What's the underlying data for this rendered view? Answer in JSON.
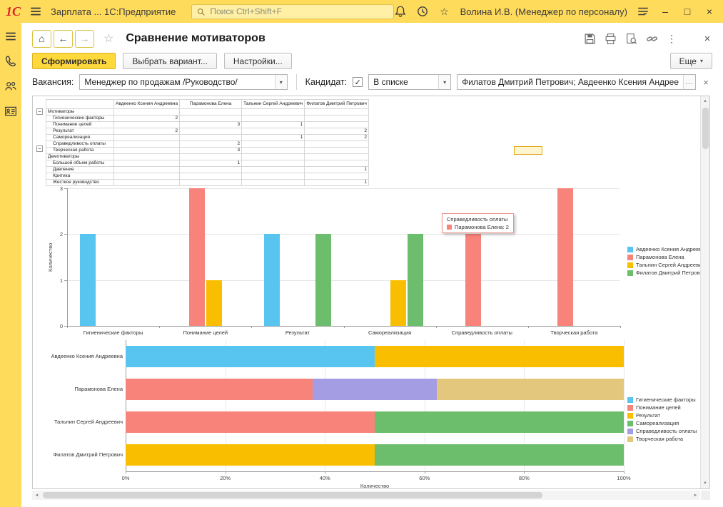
{
  "titlebar": {
    "logo": "1С",
    "app_title": "Зарплата ...  1С:Предприятие",
    "search_placeholder": "Поиск Ctrl+Shift+F",
    "user_name": "Волина И.В. (Менеджер по персоналу)"
  },
  "icons": {
    "minimize": "–",
    "maximize": "□",
    "close": "×",
    "kebab": "⋮",
    "dropdown": "▾",
    "check": "✓",
    "choose": "...",
    "back": "←",
    "forward": "→",
    "star": "☆",
    "home": "⌂",
    "expand": "−",
    "scroll_up": "▲",
    "scroll_down": "▼",
    "scroll_left": "◄",
    "scroll_right": "►"
  },
  "form": {
    "title": "Сравнение мотиваторов",
    "buttons": {
      "generate": "Сформировать",
      "variant": "Выбрать вариант...",
      "settings": "Настройки...",
      "more": "Еще"
    },
    "filters": {
      "vacancy_label": "Вакансия:",
      "vacancy_value": "Менеджер по продажам /Руководство/",
      "candidate_label": "Кандидат:",
      "candidate_checked": true,
      "candidate_condition": "В списке",
      "candidate_value": "Филатов Дмитрий Петрович; Авдеенко Ксения Андрее"
    }
  },
  "colors": {
    "titlebar_yellow": "#ffdb5c",
    "primary_button_yellow": "#ffd83c",
    "selection_border": "#dfa713"
  },
  "pivot": {
    "columns": [
      "Авдеенко Ксения Андреевна",
      "Парамонова Елена",
      "Тальнин Сергей Андреевич",
      "Филатов Дмитрий Петрович"
    ],
    "groups": [
      {
        "label": "Мотиваторы",
        "rows": [
          {
            "label": "Гигиенические факторы",
            "values": [
              "2",
              "",
              "",
              ""
            ]
          },
          {
            "label": "Понимание целей",
            "values": [
              "",
              "3",
              "1",
              ""
            ]
          },
          {
            "label": "Результат",
            "values": [
              "2",
              "",
              "",
              "2"
            ]
          },
          {
            "label": "Самореализация",
            "values": [
              "",
              "",
              "1",
              "2"
            ]
          },
          {
            "label": "Справедливость оплаты",
            "values": [
              "",
              "2",
              "",
              ""
            ]
          },
          {
            "label": "Творческая работа",
            "values": [
              "",
              "3",
              "",
              ""
            ]
          }
        ]
      },
      {
        "label": "Демотиваторы",
        "rows": [
          {
            "label": "Большой объем работы",
            "values": [
              "",
              "1",
              "",
              ""
            ]
          },
          {
            "label": "Давление",
            "values": [
              "",
              "",
              "",
              "1"
            ]
          },
          {
            "label": "Критика",
            "values": [
              "",
              "",
              "",
              ""
            ]
          },
          {
            "label": "Жесткое руководство",
            "values": [
              "",
              "",
              "",
              "1"
            ]
          }
        ]
      }
    ]
  },
  "chart_data": [
    {
      "type": "bar",
      "title": "",
      "categories": [
        "Гигиенические факторы",
        "Понимание целей",
        "Результат",
        "Самореализация",
        "Справедливость оплаты",
        "Творческая работа"
      ],
      "series": [
        {
          "name": "Авдеенко Ксения Андреевна",
          "color": "#58C4F0",
          "values": [
            2,
            0,
            2,
            0,
            0,
            0
          ]
        },
        {
          "name": "Парамонова Елена",
          "color": "#F8837B",
          "values": [
            0,
            3,
            0,
            0,
            2,
            3
          ]
        },
        {
          "name": "Тальнин Сергей Андреевич",
          "color": "#F9BE00",
          "values": [
            0,
            1,
            0,
            1,
            0,
            0
          ]
        },
        {
          "name": "Филатов Дмитрий Петрович",
          "color": "#6CBE6C",
          "values": [
            0,
            0,
            2,
            2,
            0,
            0
          ]
        }
      ],
      "xlabel": "",
      "ylabel": "Количество",
      "ylim": [
        0,
        3
      ],
      "grid": true,
      "legend_position": "right",
      "tooltip": {
        "title": "Справедливость оплаты",
        "series": "Парамонова Елена",
        "value": "2"
      }
    },
    {
      "type": "area",
      "subtype": "horizontal-stacked-100-percent-bar",
      "categories": [
        "Авдеенко Ксения Андреевна",
        "Парамонова Елена",
        "Тальнин Сергей Андреевич",
        "Филатов Дмитрий Петрович"
      ],
      "series": [
        {
          "name": "Гигиенические факторы",
          "color": "#58C4F0",
          "values": [
            2,
            0,
            0,
            0
          ]
        },
        {
          "name": "Понимание целей",
          "color": "#F8837B",
          "values": [
            0,
            3,
            1,
            0
          ]
        },
        {
          "name": "Результат",
          "color": "#F9BE00",
          "values": [
            2,
            0,
            0,
            2
          ]
        },
        {
          "name": "Самореализация",
          "color": "#6CBE6C",
          "values": [
            0,
            0,
            1,
            2
          ]
        },
        {
          "name": "Справедливость оплаты",
          "color": "#A49DE3",
          "values": [
            0,
            2,
            0,
            0
          ]
        },
        {
          "name": "Творческая работа",
          "color": "#E2C77D",
          "values": [
            0,
            3,
            0,
            0
          ]
        }
      ],
      "xticks": [
        "0%",
        "20%",
        "40%",
        "60%",
        "80%",
        "100%"
      ],
      "xlim_percent": [
        0,
        100
      ],
      "xlabel": "Количество",
      "grid": true,
      "legend_position": "right"
    }
  ]
}
